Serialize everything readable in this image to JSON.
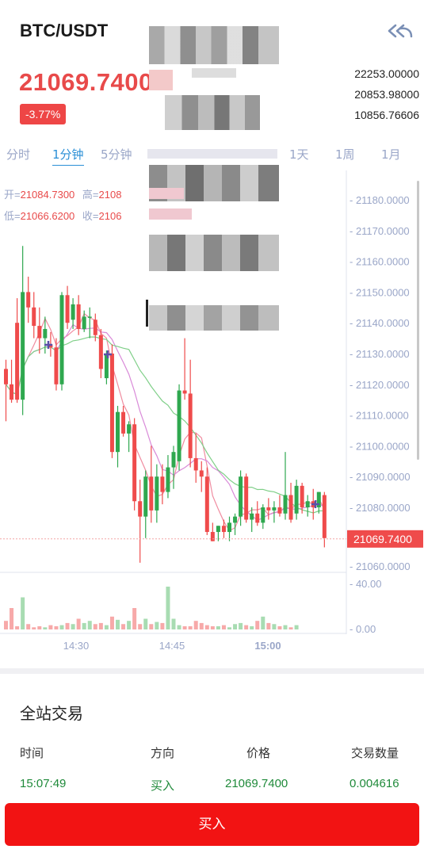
{
  "header": {
    "pair": "BTC/USDT",
    "price": "21069.7400",
    "change": "-3.77%",
    "stats": [
      "22253.00000",
      "20853.98000",
      "10856.76606"
    ]
  },
  "tabs": [
    {
      "label": "分时",
      "active": false
    },
    {
      "label": "1分钟",
      "active": true
    },
    {
      "label": "5分钟",
      "active": false
    },
    {
      "label": "1天",
      "active": false
    },
    {
      "label": "1周",
      "active": false
    },
    {
      "label": "1月",
      "active": false
    }
  ],
  "ohlc": {
    "open_label": "开=",
    "open": "21084.7300",
    "high_label": "高=",
    "high": "2108",
    "low_label": "低=",
    "low": "21066.6200",
    "close_label": "收=",
    "close": "2106"
  },
  "chart_data": {
    "type": "candlestick",
    "price_axis": [
      "21180.0000",
      "21170.0000",
      "21160.0000",
      "21150.0000",
      "21140.0000",
      "21130.0000",
      "21120.0000",
      "21110.0000",
      "21100.0000",
      "21090.0000",
      "21080.0000",
      "21060.0000"
    ],
    "current_price_label": "21069.7400",
    "current_price": 21069.74,
    "ylim": [
      21060,
      21190
    ],
    "volume_axis": [
      "40.00",
      "0.00"
    ],
    "time_labels": [
      "14:30",
      "14:45",
      "15:00"
    ],
    "candles": [
      {
        "o": 21125,
        "h": 21128,
        "l": 21108,
        "c": 21120
      },
      {
        "o": 21120,
        "h": 21128,
        "l": 21114,
        "c": 21115
      },
      {
        "o": 21140,
        "h": 21148,
        "l": 21114,
        "c": 21115
      },
      {
        "o": 21115,
        "h": 21165,
        "l": 21110,
        "c": 21150
      },
      {
        "o": 21150,
        "h": 21155,
        "l": 21140,
        "c": 21145
      },
      {
        "o": 21145,
        "h": 21150,
        "l": 21135,
        "c": 21139
      },
      {
        "o": 21139,
        "h": 21145,
        "l": 21130,
        "c": 21135
      },
      {
        "o": 21135,
        "h": 21142,
        "l": 21130,
        "c": 21138
      },
      {
        "o": 21133,
        "h": 21137,
        "l": 21129,
        "c": 21132
      },
      {
        "o": 21132,
        "h": 21135,
        "l": 21118,
        "c": 21120
      },
      {
        "o": 21120,
        "h": 21150,
        "l": 21118,
        "c": 21149
      },
      {
        "o": 21149,
        "h": 21152,
        "l": 21138,
        "c": 21140
      },
      {
        "o": 21141,
        "h": 21148,
        "l": 21138,
        "c": 21146
      },
      {
        "o": 21146,
        "h": 21149,
        "l": 21136,
        "c": 21138
      },
      {
        "o": 21138,
        "h": 21144,
        "l": 21137,
        "c": 21142
      },
      {
        "o": 21142,
        "h": 21145,
        "l": 21135,
        "c": 21142
      },
      {
        "o": 21141,
        "h": 21143,
        "l": 21134,
        "c": 21136
      },
      {
        "o": 21136,
        "h": 21138,
        "l": 21122,
        "c": 21125
      },
      {
        "o": 21122,
        "h": 21131,
        "l": 21120,
        "c": 21130
      },
      {
        "o": 21130,
        "h": 21133,
        "l": 21096,
        "c": 21098
      },
      {
        "o": 21098,
        "h": 21113,
        "l": 21093,
        "c": 21111
      },
      {
        "o": 21111,
        "h": 21113,
        "l": 21103,
        "c": 21104
      },
      {
        "o": 21104,
        "h": 21108,
        "l": 21098,
        "c": 21107
      },
      {
        "o": 21107,
        "h": 21109,
        "l": 21079,
        "c": 21082
      },
      {
        "o": 21082,
        "h": 21089,
        "l": 21062,
        "c": 21077
      },
      {
        "o": 21077,
        "h": 21092,
        "l": 21070,
        "c": 21090
      },
      {
        "o": 21090,
        "h": 21100,
        "l": 21075,
        "c": 21079
      },
      {
        "o": 21079,
        "h": 21094,
        "l": 21075,
        "c": 21090
      },
      {
        "o": 21090,
        "h": 21094,
        "l": 21081,
        "c": 21085
      },
      {
        "o": 21085,
        "h": 21097,
        "l": 21083,
        "c": 21093
      },
      {
        "o": 21093,
        "h": 21100,
        "l": 21086,
        "c": 21098
      },
      {
        "o": 21095,
        "h": 21120,
        "l": 21092,
        "c": 21118
      },
      {
        "o": 21118,
        "h": 21135,
        "l": 21115,
        "c": 21117
      },
      {
        "o": 21117,
        "h": 21128,
        "l": 21093,
        "c": 21096
      },
      {
        "o": 21096,
        "h": 21104,
        "l": 21088,
        "c": 21092
      },
      {
        "o": 21092,
        "h": 21095,
        "l": 21085,
        "c": 21090
      },
      {
        "o": 21090,
        "h": 21093,
        "l": 21071,
        "c": 21072
      },
      {
        "o": 21072,
        "h": 21075,
        "l": 21069,
        "c": 21069
      },
      {
        "o": 21072,
        "h": 21074,
        "l": 21069,
        "c": 21074
      },
      {
        "o": 21074,
        "h": 21076,
        "l": 21070,
        "c": 21072
      },
      {
        "o": 21072,
        "h": 21077,
        "l": 21069,
        "c": 21075
      },
      {
        "o": 21075,
        "h": 21078,
        "l": 21071,
        "c": 21077
      },
      {
        "o": 21077,
        "h": 21092,
        "l": 21074,
        "c": 21090
      },
      {
        "o": 21090,
        "h": 21091,
        "l": 21075,
        "c": 21076
      },
      {
        "o": 21076,
        "h": 21080,
        "l": 21072,
        "c": 21078
      },
      {
        "o": 21078,
        "h": 21082,
        "l": 21074,
        "c": 21075
      },
      {
        "o": 21075,
        "h": 21081,
        "l": 21073,
        "c": 21080
      },
      {
        "o": 21080,
        "h": 21083,
        "l": 21076,
        "c": 21079
      },
      {
        "o": 21079,
        "h": 21082,
        "l": 21075,
        "c": 21080
      },
      {
        "o": 21080,
        "h": 21084,
        "l": 21077,
        "c": 21078
      },
      {
        "o": 21078,
        "h": 21098,
        "l": 21076,
        "c": 21084
      },
      {
        "o": 21084,
        "h": 21088,
        "l": 21075,
        "c": 21076
      },
      {
        "o": 21078,
        "h": 21089,
        "l": 21076,
        "c": 21087
      },
      {
        "o": 21087,
        "h": 21088,
        "l": 21078,
        "c": 21080
      },
      {
        "o": 21080,
        "h": 21084,
        "l": 21077,
        "c": 21082
      },
      {
        "o": 21082,
        "h": 21086,
        "l": 21076,
        "c": 21080
      },
      {
        "o": 21080,
        "h": 21085,
        "l": 21078,
        "c": 21085
      },
      {
        "o": 21084,
        "h": 21085,
        "l": 21067,
        "c": 21070
      }
    ],
    "volumes": [
      8,
      20,
      3,
      30,
      5,
      2,
      3,
      2,
      4,
      3,
      4,
      6,
      5,
      10,
      6,
      8,
      5,
      6,
      4,
      12,
      9,
      5,
      8,
      20,
      5,
      10,
      5,
      7,
      6,
      40,
      10,
      4,
      3,
      3,
      8,
      6,
      4,
      3,
      3,
      4,
      2,
      5,
      6,
      4,
      3,
      8,
      12,
      6,
      5,
      3,
      4,
      2,
      4
    ]
  },
  "trades": {
    "title": "全站交易",
    "headers": [
      "时间",
      "方向",
      "价格",
      "交易数量"
    ],
    "rows": [
      {
        "time": "15:07:49",
        "side": "买入",
        "price": "21069.7400",
        "amount": "0.004616"
      }
    ]
  },
  "buy_button": "买入",
  "colors": {
    "up": "#2fa84f",
    "down": "#ef4b4b",
    "accent": "#2a8fd6",
    "buy": "#f21313"
  }
}
